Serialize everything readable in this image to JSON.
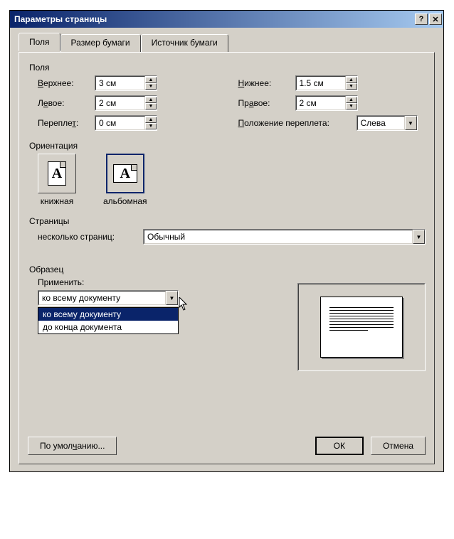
{
  "window": {
    "title": "Параметры страницы"
  },
  "tabs": {
    "margins": "Поля",
    "paper_size": "Размер бумаги",
    "paper_source": "Источник бумаги"
  },
  "margins": {
    "section_label": "Поля",
    "top_label": "Верхнее:",
    "top_value": "3 см",
    "bottom_label": "Нижнее:",
    "bottom_value": "1.5 см",
    "bottom_hotkey": "Н",
    "left_label": "Левое:",
    "left_value": "2 см",
    "left_hotkey": "е",
    "right_label": "Правое:",
    "right_value": "2 см",
    "right_hotkey": "а",
    "gutter_label": "Переплет:",
    "gutter_value": "0 см",
    "gutter_hotkey": "т",
    "gutter_pos_label": "Положение переплета:",
    "gutter_pos_value": "Слева",
    "gutter_pos_hotkey": "П"
  },
  "orientation": {
    "section_label": "Ориентация",
    "portrait_label": "книжная",
    "landscape_label": "альбомная"
  },
  "pages": {
    "section_label": "Страницы",
    "multi_label": "несколько страниц:",
    "multi_value": "Обычный"
  },
  "sample": {
    "section_label": "Образец",
    "apply_label": "Применить:",
    "apply_value": "ко всему документу",
    "options": [
      "ко всему документу",
      "до конца документа"
    ]
  },
  "buttons": {
    "default": "По умолчанию...",
    "default_hotkey": "ч",
    "ok": "ОК",
    "cancel": "Отмена"
  }
}
